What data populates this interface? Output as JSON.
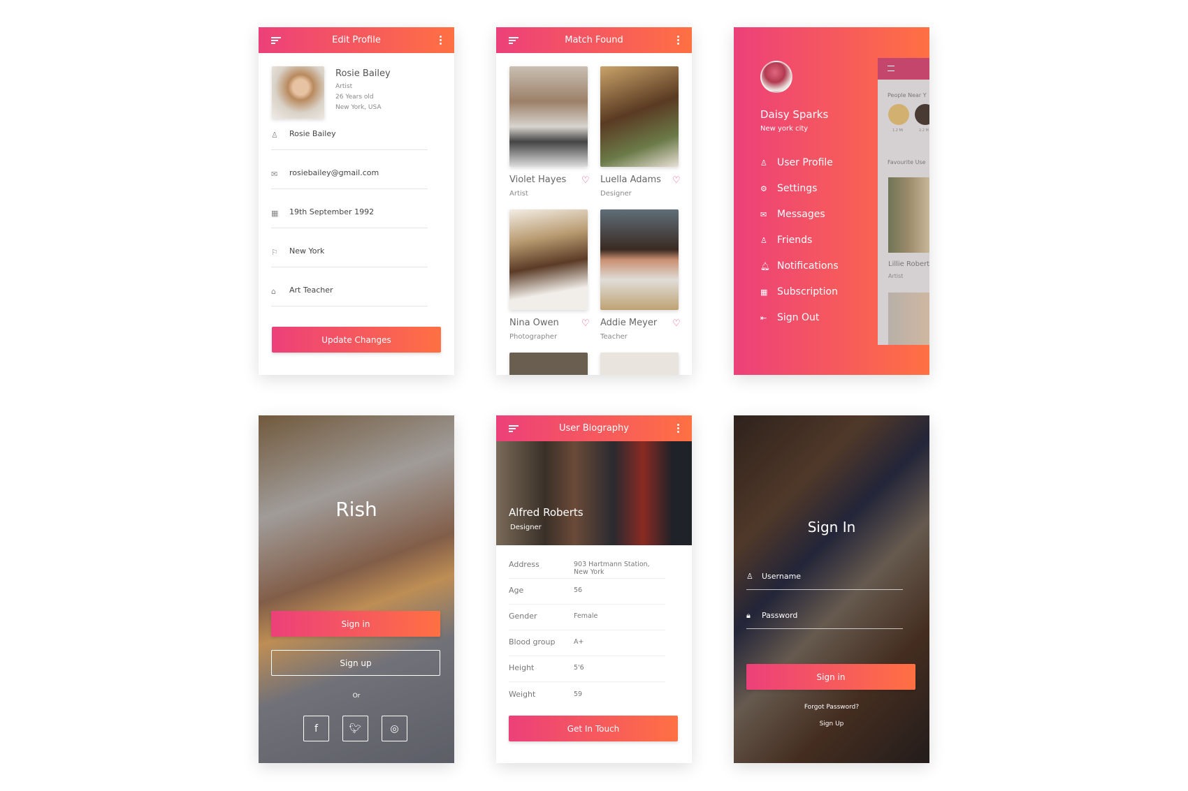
{
  "colors": {
    "gradient_start": "#ec407a",
    "gradient_end": "#ff7043"
  },
  "edit_profile": {
    "title": "Edit Profile",
    "name": "Rosie Bailey",
    "role": "Artist",
    "age": "26 Years old",
    "location": "New York, USA",
    "fields": [
      {
        "icon": "user-icon",
        "value": "Rosie Bailey"
      },
      {
        "icon": "mail-icon",
        "value": "rosiebailey@gmail.com"
      },
      {
        "icon": "calendar-icon",
        "value": "19th September 1992"
      },
      {
        "icon": "signpost-icon",
        "value": "New York"
      },
      {
        "icon": "briefcase-icon",
        "value": "Art Teacher"
      }
    ],
    "button": "Update Changes"
  },
  "match_found": {
    "title": "Match Found",
    "cards": [
      {
        "name": "Violet Hayes",
        "role": "Artist"
      },
      {
        "name": "Luella Adams",
        "role": "Designer"
      },
      {
        "name": "Nina Owen",
        "role": "Photographer"
      },
      {
        "name": "Addie Meyer",
        "role": "Teacher"
      }
    ]
  },
  "drawer": {
    "name": "Daisy Sparks",
    "city": "New york city",
    "items": [
      {
        "icon": "user-icon",
        "label": "User Profile"
      },
      {
        "icon": "gear-icon",
        "label": "Settings"
      },
      {
        "icon": "mail-icon",
        "label": "Messages"
      },
      {
        "icon": "friends-icon",
        "label": "Friends"
      },
      {
        "icon": "bell-icon",
        "label": "Notifications"
      },
      {
        "icon": "calendar-icon",
        "label": "Subscription"
      },
      {
        "icon": "sign-out-icon",
        "label": "Sign Out"
      }
    ],
    "preview": {
      "people_near": "People Near Y",
      "dist1": "1.2 Mi",
      "dist2": "2.2 M",
      "favourite": "Favourite Use",
      "fav_name": "Lillie Robert",
      "fav_role": "Artist"
    }
  },
  "landing": {
    "brand": "Rish",
    "sign_in": "Sign in",
    "sign_up": "Sign up",
    "or": "Or",
    "social": [
      "facebook-icon",
      "twitter-icon",
      "instagram-icon"
    ]
  },
  "biography": {
    "title": "User Biography",
    "name": "Alfred Roberts",
    "role": "Designer",
    "rows": [
      {
        "label": "Address",
        "value": "903 Hartmann Station, New York"
      },
      {
        "label": "Age",
        "value": "56"
      },
      {
        "label": "Gender",
        "value": "Female"
      },
      {
        "label": "Blood group",
        "value": "A+"
      },
      {
        "label": "Height",
        "value": "5'6"
      },
      {
        "label": "Weight",
        "value": "59"
      }
    ],
    "button": "Get In Touch"
  },
  "sign_in": {
    "title": "Sign In",
    "username_placeholder": "Username",
    "password_placeholder": "Password",
    "button": "Sign in",
    "forgot": "Forgot Password?",
    "sign_up": "Sign Up"
  }
}
